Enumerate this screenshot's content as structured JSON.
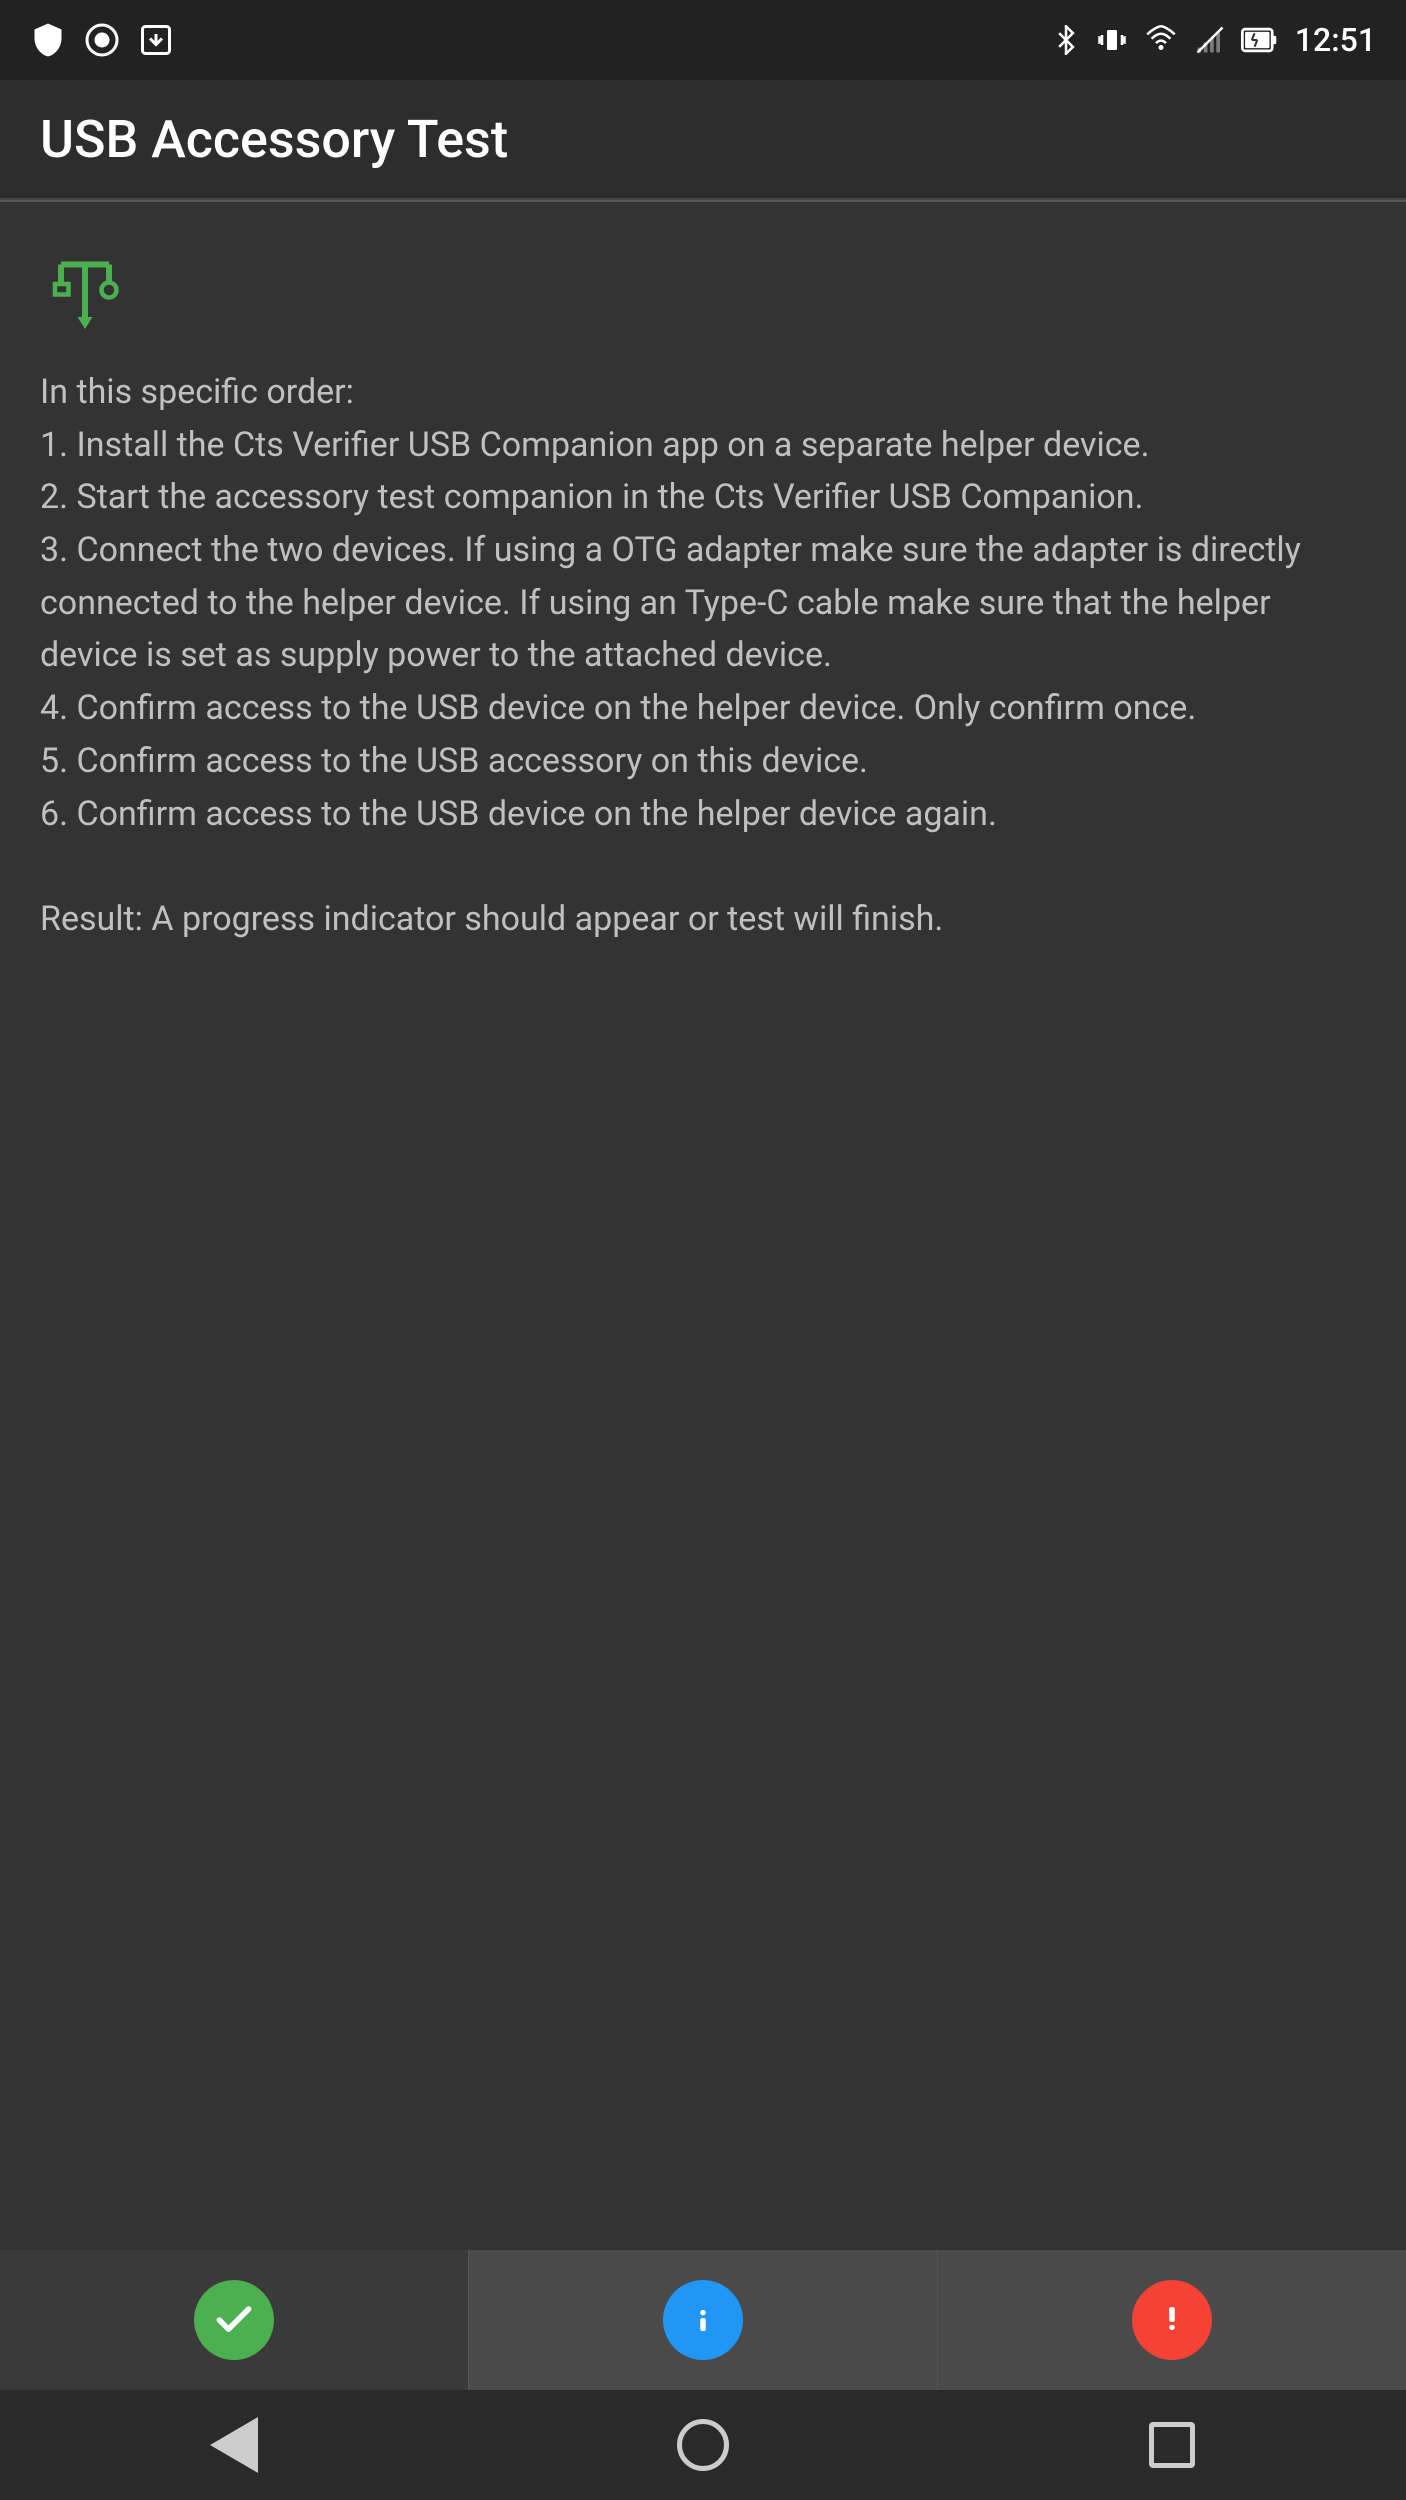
{
  "statusBar": {
    "time": "12:51",
    "icons": {
      "bluetooth": "BT",
      "vibrate": "📳",
      "wifi": "WiFi",
      "signal": "SIG",
      "battery": "BAT"
    }
  },
  "appBar": {
    "title": "USB Accessory Test"
  },
  "content": {
    "usbIconLabel": "USB symbol",
    "instructions": "In this specific order:\n1. Install the Cts Verifier USB Companion app on a separate helper device.\n2. Start the accessory test companion in the Cts Verifier USB Companion.\n3. Connect the two devices. If using a OTG adapter make sure the adapter is directly connected to the helper device. If using an Type-C cable make sure that the helper device is set as supply power to the attached device.\n4. Confirm access to the USB device on the helper device. Only confirm once.\n5. Confirm access to the USB accessory on this device.\n6. Confirm access to the USB device on the helper device again.\n\nResult: A progress indicator should appear or test will finish."
  },
  "actionButtons": {
    "pass": {
      "label": "Pass",
      "icon": "✓",
      "color": "#4caf50"
    },
    "info": {
      "label": "Info",
      "icon": "?",
      "color": "#2196f3"
    },
    "fail": {
      "label": "Fail",
      "icon": "!",
      "color": "#f44336"
    }
  },
  "navBar": {
    "back": "Back",
    "home": "Home",
    "recents": "Recents"
  }
}
